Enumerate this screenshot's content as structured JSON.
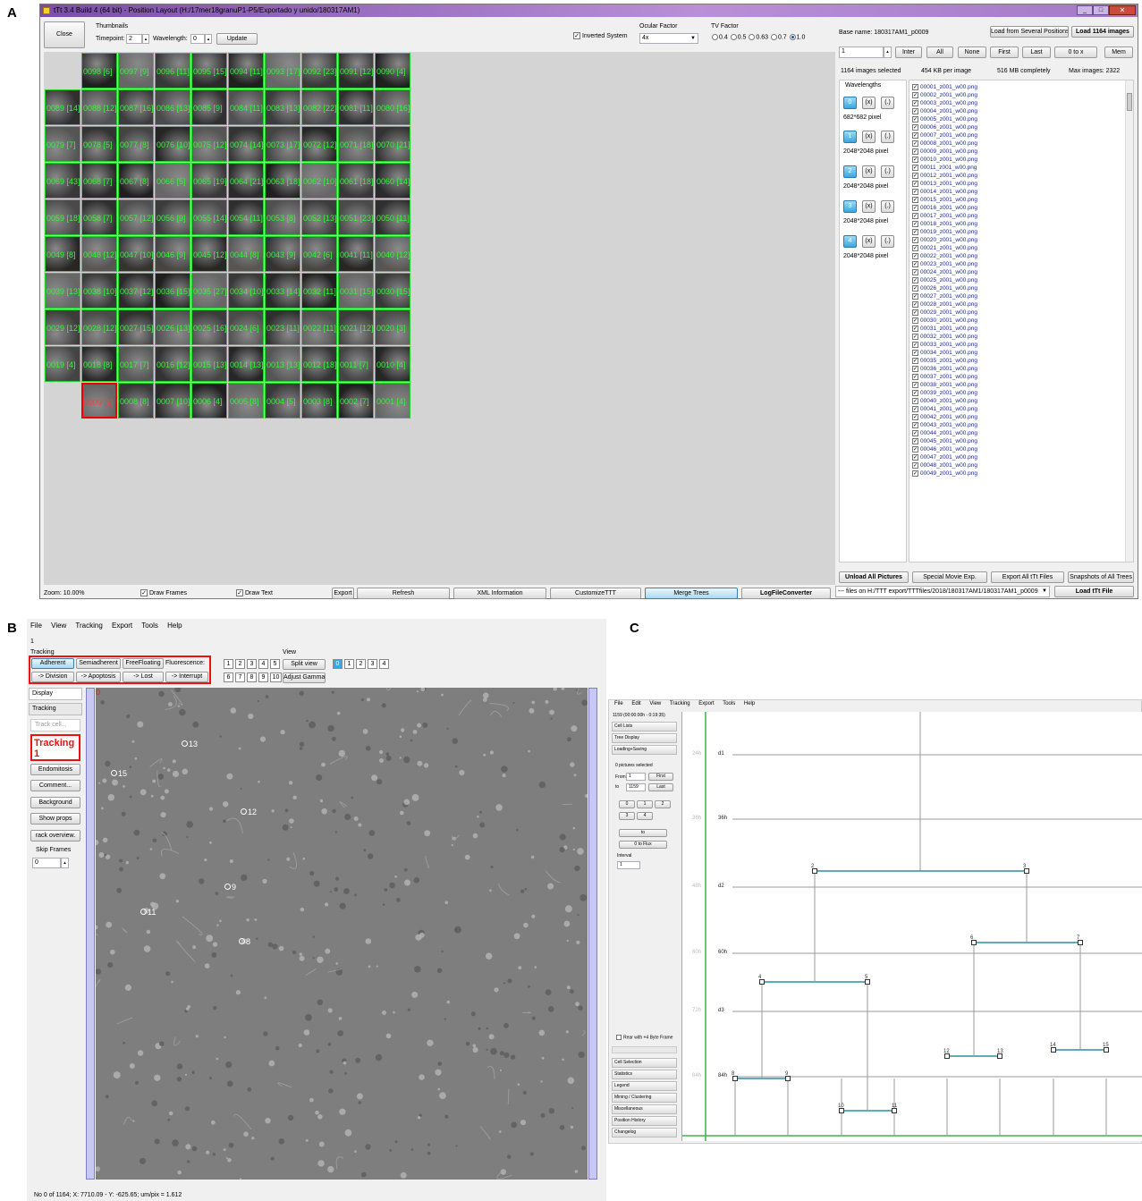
{
  "labels": {
    "a": "A",
    "b": "B",
    "c": "C"
  },
  "panelA": {
    "window_title": "tTt 3.4 Build 4 (64 bit) - Position Layout (H:/17mer18granuP1-P5/Exportado y unido/180317AM1)",
    "close": "Close",
    "thumbnails": "Thumbnails",
    "timepoint_label": "Timepoint:",
    "timepoint_value": "2",
    "wavelength_label": "Wavelength:",
    "wavelength_value": "0",
    "update": "Update",
    "inverted_system": "Inverted System",
    "ocular_factor": "Ocular Factor",
    "ocular_value": "4x",
    "tv_factor": "TV Factor",
    "tv_options": [
      "0.4",
      "0.5",
      "0.63",
      "0.7",
      "1.0"
    ],
    "tv_selected": "1.0",
    "base_name": "Base name: 180317AM1_p0009",
    "load_several": "Load from Several Positions",
    "load_1164": "Load 1164 images",
    "spin_value": "1",
    "inter": "Inter",
    "all": "All",
    "none": "None",
    "first": "First",
    "last": "Last",
    "zero_to_x": "0 to x",
    "mem": "Mem",
    "selected_info": "1164 images selected",
    "kb_per_image": "454 KB per image",
    "mb_completely": "516 MB completely",
    "max_images": "Max images: 2322",
    "wavelengths": "Wavelengths",
    "wl": [
      {
        "num": "0",
        "x": "(x)",
        "dot": "(.)",
        "px": "682*682 pixel"
      },
      {
        "num": "1",
        "x": "(x)",
        "dot": "(.)",
        "px": "2048*2048 pixel"
      },
      {
        "num": "2",
        "x": "(x)",
        "dot": "(.)",
        "px": "2048*2048 pixel"
      },
      {
        "num": "3",
        "x": "(x)",
        "dot": "(.)",
        "px": "2048*2048 pixel"
      },
      {
        "num": "4",
        "x": "(x)",
        "dot": "(.)",
        "px": "2048*2048 pixel"
      }
    ],
    "files": [
      "00001_z001_w00.png",
      "00002_z001_w00.png",
      "00003_z001_w00.png",
      "00004_z001_w00.png",
      "00005_z001_w00.png",
      "00006_z001_w00.png",
      "00007_z001_w00.png",
      "00008_z001_w00.png",
      "00009_z001_w00.png",
      "00010_z001_w00.png",
      "00011_z001_w00.png",
      "00012_z001_w00.png",
      "00013_z001_w00.png",
      "00014_z001_w00.png",
      "00015_z001_w00.png",
      "00016_z001_w00.png",
      "00017_z001_w00.png",
      "00018_z001_w00.png",
      "00019_z001_w00.png",
      "00020_z001_w00.png",
      "00021_z001_w00.png",
      "00022_z001_w00.png",
      "00023_z001_w00.png",
      "00024_z001_w00.png",
      "00025_z001_w00.png",
      "00026_z001_w00.png",
      "00027_z001_w00.png",
      "00028_z001_w00.png",
      "00029_z001_w00.png",
      "00030_z001_w00.png",
      "00031_z001_w00.png",
      "00032_z001_w00.png",
      "00033_z001_w00.png",
      "00034_z001_w00.png",
      "00035_z001_w00.png",
      "00036_z001_w00.png",
      "00037_z001_w00.png",
      "00038_z001_w00.png",
      "00039_z001_w00.png",
      "00040_z001_w00.png",
      "00041_z001_w00.png",
      "00042_z001_w00.png",
      "00043_z001_w00.png",
      "00044_z001_w00.png",
      "00045_z001_w00.png",
      "00046_z001_w00.png",
      "00047_z001_w00.png",
      "00048_z001_w00.png",
      "00049_z001_w00.png"
    ],
    "unload": "Unload All Pictures",
    "special_movie": "Special Movie Exp.",
    "export_ttt": "Export All tTt Files",
    "snapshots": "Snapshots of All Trees",
    "files_on": "--- files on H:/TTT export/TTTfiles/2018/180317AM1/180317AM1_p0009",
    "load_ttt": "Load tTt File",
    "zoom": "Zoom: 10.00%",
    "draw_frames": "Draw Frames",
    "draw_text": "Draw Text",
    "export": "Export",
    "refresh": "Refresh",
    "xml": "XML Information",
    "customize": "CustomizeTTT",
    "merge": "Merge Trees",
    "logfile": "LogFileConverter",
    "tiles": [
      [
        "",
        "0098 [6]",
        "0097 [9]",
        "0096 [11]",
        "0095 [15]",
        "0094 [11]",
        "0093 [17]",
        "0092 [23]",
        "0091 [12]",
        "0090 [4]"
      ],
      [
        "0089 [14]",
        "0088 [12]",
        "0087 [16]",
        "0086 [13]",
        "0085 [9]",
        "0084 [11]",
        "0083 [13]",
        "0082 [22]",
        "0081 [11]",
        "0080 [16]"
      ],
      [
        "0079 [7]",
        "0078 [5]",
        "0077 [8]",
        "0076 [10]",
        "0075 [12]",
        "0074 [14]",
        "0073 [17]",
        "0072 [12]",
        "0071 [18]",
        "0070 [21]"
      ],
      [
        "0069 [43]",
        "0068 [7]",
        "0067 [8]",
        "0066 [5]",
        "0065 [19]",
        "0064 [21]",
        "0063 [18]",
        "0062 [10]",
        "0061 [18]",
        "0060 [14]"
      ],
      [
        "0059 [18]",
        "0058 [7]",
        "0057 [12]",
        "0056 [9]",
        "0055 [14]",
        "0054 [11]",
        "0053 [8]",
        "0052 [13]",
        "0051 [23]",
        "0050 [11]"
      ],
      [
        "0049 [8]",
        "0048 [12]",
        "0047 [10]",
        "0046 [9]",
        "0045 [12]",
        "0044 [8]",
        "0043 [9]",
        "0042 [6]",
        "0041 [11]",
        "0040 [12]"
      ],
      [
        "0039 [13]",
        "0038 [10]",
        "0037 [12]",
        "0036 [15]",
        "0035 [27]",
        "0034 [10]",
        "0033 [14]",
        "0032 [11]",
        "0031 [15]",
        "0030 [15]"
      ],
      [
        "0029 [12]",
        "0028 [12]",
        "0027 [15]",
        "0026 [13]",
        "0025 [16]",
        "0024 [6]",
        "0023 [11]",
        "0022 [11]",
        "0021 [12]",
        "0020 [3]"
      ],
      [
        "0019 [4]",
        "0018 [8]",
        "0017 [7]",
        "0016 [12]",
        "0015 [13]",
        "0014 [13]",
        "0013 [13]",
        "0012 [18]",
        "0011 [7]",
        "0010 [4]"
      ],
      [
        "",
        "0009 [9]",
        "0008 [8]",
        "0007 [10]",
        "0006 [4]",
        "0005 [8]",
        "0004 [5]",
        "0003 [8]",
        "0002 [7]",
        "0001 [4]"
      ]
    ]
  },
  "panelB": {
    "menu": [
      "File",
      "View",
      "Tracking",
      "Export",
      "Tools",
      "Help"
    ],
    "index": "1",
    "tracking": "Tracking",
    "view": "View",
    "adherent": "Adherent",
    "semiadherent": "Semiadherent",
    "freefloating": "FreeFloating",
    "fluorescence": "Fluorescence:",
    "division": "-> Division",
    "apoptosis": "-> Apoptosis",
    "lost": "-> Lost",
    "interrupt": "-> Interrupt",
    "fl_nums": [
      "1",
      "2",
      "3",
      "4",
      "5",
      "6",
      "7",
      "8",
      "9",
      "10"
    ],
    "split_view": "Split view",
    "adjust_gamma": "Adjust Gamma",
    "view_nums": [
      "0",
      "1",
      "2",
      "3",
      "4"
    ],
    "display": "Display",
    "tracking_tab": "Tracking",
    "track_cell": "Track cell...",
    "tracking1_a": "Tracking",
    "tracking1_b": "1",
    "endomitosis": "Endomitosis",
    "comment": "Comment...",
    "background": "Background",
    "show_props": "Show props",
    "track_overview": "rack overview.",
    "skip_frames": "Skip Frames",
    "skip_value": "0",
    "corner": "0",
    "cells": [
      {
        "n": "13"
      },
      {
        "n": "15"
      },
      {
        "n": "12"
      },
      {
        "n": "9"
      },
      {
        "n": "11"
      },
      {
        "n": "8"
      }
    ],
    "status": "No 0 of 1164; X: 7710.09 - Y: -625.65; um/pix = 1.612"
  },
  "panelC": {
    "menu": [
      "File",
      "Edit",
      "View",
      "Tracking",
      "Export",
      "Tools",
      "Help"
    ],
    "header": "1159 (00:00:00h - 0:19:35)",
    "cell_lists": "Cell Lists",
    "tree_display": "Tree Display",
    "loading": "Loading+Saving",
    "pictures_selected": "0 pictures selected",
    "from_label": "From",
    "from_value": "1",
    "first": "First",
    "to_label": "to",
    "to_value": "1159",
    "last": "Last",
    "wl_btns": [
      "0",
      "1",
      "2",
      "3",
      "4"
    ],
    "to_btn": "to",
    "zero_to_flux": "0 to Flux",
    "interval": "Interval",
    "interval_value": "1",
    "rear": "Rear with +4 Byte Frame",
    "side_bottom": [
      "Cell Selection",
      "Statistics",
      "Legend",
      "Mining / Clustering",
      "Miscellaneous",
      "Position History",
      "Changelog"
    ],
    "time_labels": [
      "d1",
      "36h",
      "d2",
      "60h",
      "d3",
      "84h"
    ],
    "scale_labels": [
      "24h",
      "36h",
      "48h",
      "60h",
      "72h",
      "84h"
    ],
    "generation_labels": [
      "2",
      "3",
      "4",
      "5",
      "6",
      "7",
      "8",
      "9",
      "10",
      "11",
      "12",
      "13",
      "14",
      "15"
    ]
  }
}
